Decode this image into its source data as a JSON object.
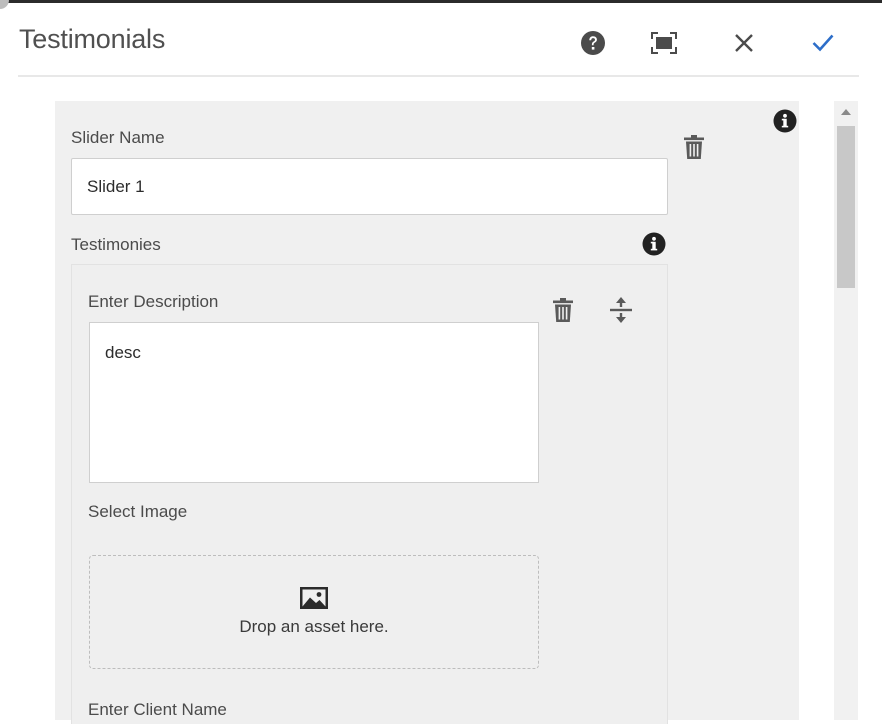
{
  "dialog": {
    "title": "Testimonials",
    "buttons": {
      "help": "help-icon",
      "fullscreen": "fullscreen-icon",
      "close": "close-icon",
      "done": "checkmark-icon"
    },
    "accent_color": "#2d6ec9"
  },
  "form": {
    "slider_name": {
      "label": "Slider Name",
      "value": "Slider 1"
    },
    "testimonies": {
      "label": "Testimonies",
      "item": {
        "description": {
          "label": "Enter Description",
          "value": "desc"
        },
        "image": {
          "label": "Select Image",
          "dropzone_text": "Drop an asset here."
        },
        "client_name": {
          "label": "Enter Client Name"
        }
      }
    }
  }
}
